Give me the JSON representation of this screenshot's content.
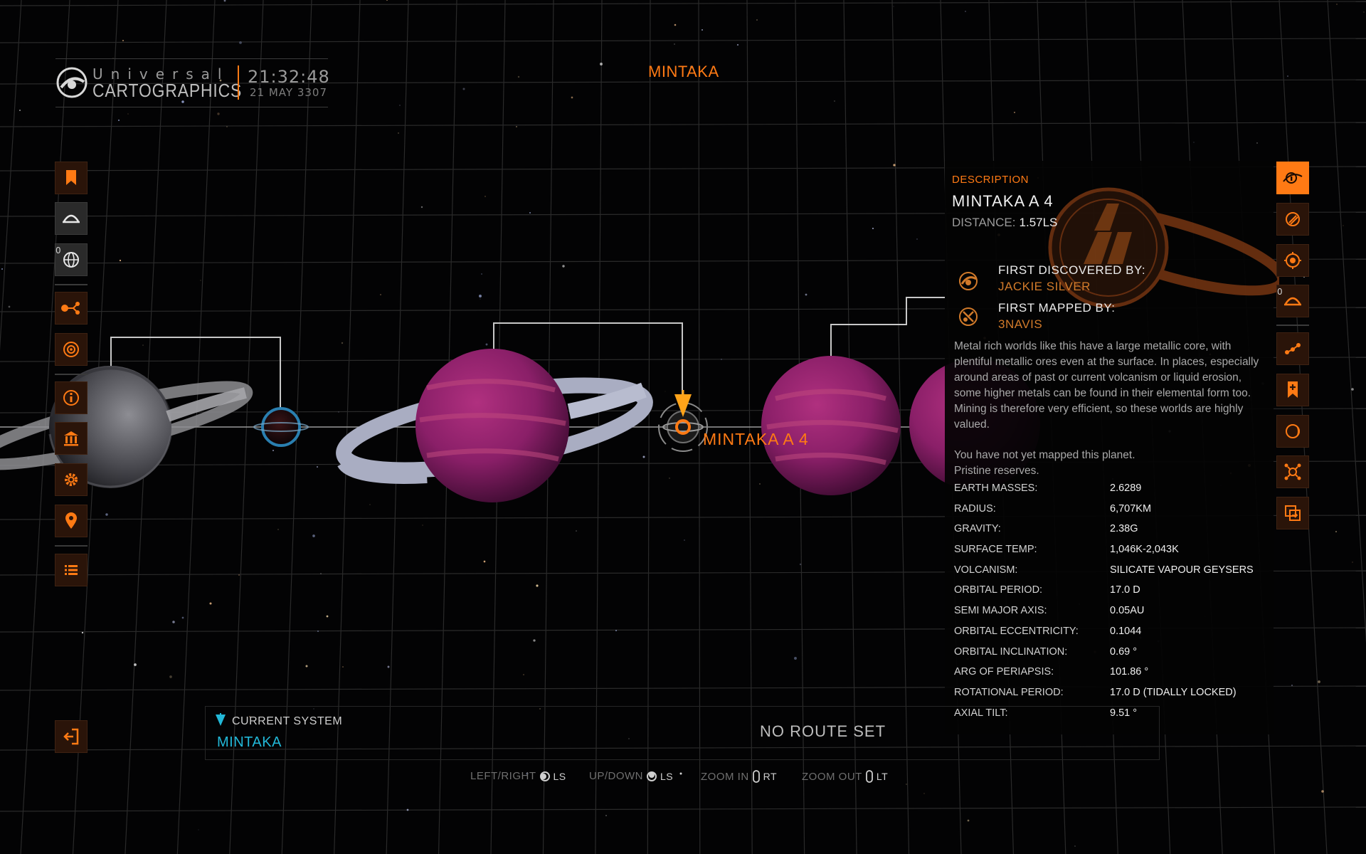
{
  "header": {
    "logo_line1": "Universal",
    "logo_line2": "CARTOGRAPHICS",
    "time": "21:32:48",
    "date": "21 MAY 3307",
    "system_title": "MINTAKA"
  },
  "left_nav": {
    "badge": "0",
    "items": [
      "bookmark-icon",
      "rings-icon",
      "globe-icon",
      "route-icon",
      "galaxy-icon",
      "info-icon",
      "station-icon",
      "settings-icon",
      "location-pin-icon",
      "list-icon"
    ],
    "exit": "exit-icon"
  },
  "right_nav": {
    "badge": "0",
    "items": [
      "system-info-icon",
      "cargo-icon",
      "target-icon",
      "rings-icon",
      "route-icon",
      "bookmark-add-icon",
      "moon-icon",
      "scan-icon",
      "swap-icon"
    ]
  },
  "map": {
    "selected_body_label": "MINTAKA A 4"
  },
  "info_panel": {
    "section_label": "DESCRIPTION",
    "body_name": "MINTAKA A 4",
    "distance_label": "DISTANCE:",
    "distance_value": "1.57LS",
    "first_discovered_label": "FIRST DISCOVERED BY:",
    "first_discovered_value": "JACKIE SILVER",
    "first_mapped_label": "FIRST MAPPED BY:",
    "first_mapped_value": "3NAVIS",
    "description": "Metal rich worlds like this have a large metallic core, with plentiful metallic ores even at the surface. In places, especially around areas of past or current volcanism or liquid erosion, some higher metals can be found in their elemental form too. Mining is therefore very efficient, so these worlds are highly valued.",
    "status_line1": "You have not yet mapped this planet.",
    "status_line2": "Pristine reserves.",
    "stats": [
      {
        "label": "EARTH MASSES:",
        "value": "2.6289"
      },
      {
        "label": "RADIUS:",
        "value": "6,707KM"
      },
      {
        "label": "GRAVITY:",
        "value": "2.38G"
      },
      {
        "label": "SURFACE TEMP:",
        "value": "1,046K-2,043K"
      },
      {
        "label": "VOLCANISM:",
        "value": "SILICATE VAPOUR GEYSERS"
      },
      {
        "label": "ORBITAL PERIOD:",
        "value": "17.0 D"
      },
      {
        "label": "SEMI MAJOR AXIS:",
        "value": "0.05AU"
      },
      {
        "label": "ORBITAL ECCENTRICITY:",
        "value": "0.1044"
      },
      {
        "label": "ORBITAL INCLINATION:",
        "value": "0.69 °"
      },
      {
        "label": "ARG OF PERIAPSIS:",
        "value": "101.86 °"
      },
      {
        "label": "ROTATIONAL PERIOD:",
        "value": "17.0 D (TIDALLY LOCKED)"
      },
      {
        "label": "AXIAL TILT:",
        "value": "9.51 °"
      }
    ]
  },
  "bottom": {
    "current_system_label": "CURRENT SYSTEM",
    "current_system_value": "MINTAKA",
    "route_status": "NO ROUTE SET",
    "controls": [
      {
        "label": "LEFT/RIGHT",
        "key": "LS"
      },
      {
        "label": "UP/DOWN",
        "key": "LS"
      },
      {
        "label": "ZOOM IN",
        "key": "RT"
      },
      {
        "label": "ZOOM OUT",
        "key": "LT"
      }
    ]
  },
  "colors": {
    "accent": "#ff7a14",
    "current_system": "#22b8d8",
    "planet": "#a0287a"
  }
}
